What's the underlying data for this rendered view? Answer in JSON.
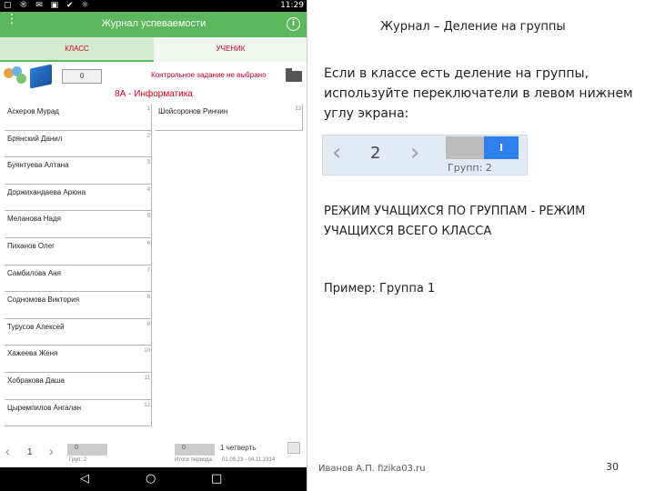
{
  "phone": {
    "status_bar": {
      "icons_left": "▢ ® ✉ ▣ ✔ ☼",
      "time": "11:29"
    },
    "app_title": "Журнал успеваемости",
    "tabs": [
      {
        "label": "КЛАСС",
        "active": true
      },
      {
        "label": "УЧЕНИК",
        "active": false
      }
    ],
    "toolbar": {
      "group_value": "0",
      "task_text": "Контрольное задание не выбрано"
    },
    "class_name": "8А - Информатика",
    "students": [
      {
        "name": "Аскеров Мурад",
        "n": "1"
      },
      {
        "name": "Брянский Данил",
        "n": "2"
      },
      {
        "name": "Буянтуева Алтана",
        "n": "3"
      },
      {
        "name": "Доржихандаева Арюна",
        "n": "4"
      },
      {
        "name": "Меланова Надя",
        "n": "5"
      },
      {
        "name": "Пиханов Олег",
        "n": "6"
      },
      {
        "name": "Самбилова Аня",
        "n": "7"
      },
      {
        "name": "Содномова Виктория",
        "n": "8"
      },
      {
        "name": "Турусов Алексей",
        "n": "9"
      },
      {
        "name": "Хажеева Женя",
        "n": "10"
      },
      {
        "name": "Хобракова Даша",
        "n": "11"
      },
      {
        "name": "Цыремпилов Ангалан",
        "n": "12"
      }
    ],
    "group_students": [
      {
        "name": "Шойсоронов Ринчин",
        "n": "13"
      }
    ],
    "bottom": {
      "page_number": "1",
      "group_label": "Груп: 2",
      "toggle_value": "0",
      "period_label": "Итоги периода",
      "toggle2_value": "0",
      "date_range": "01.09.23 - 04.11.2314",
      "quarter": "1 четверть"
    }
  },
  "slide": {
    "title": "Журнал – Деление на группы",
    "intro": "Если в классе есть деление на группы, используйте переключатели в левом нижнем углу экрана:",
    "switcher": {
      "group_number": "2",
      "toggle_label": "I",
      "groups_label": "Групп: 2"
    },
    "mode_text": "РЕЖИМ УЧАЩИХСЯ ПО ГРУППАМ - РЕЖИМ УЧАЩИХСЯ ВСЕГО КЛАССА",
    "example": "Пример: Группа 1",
    "author": "Иванов А.П. fizika03.ru",
    "page_number": "30"
  },
  "colors": {
    "appbar": "#5cb85c",
    "accent_red": "#d9001b",
    "toggle_blue": "#2f80ed"
  }
}
